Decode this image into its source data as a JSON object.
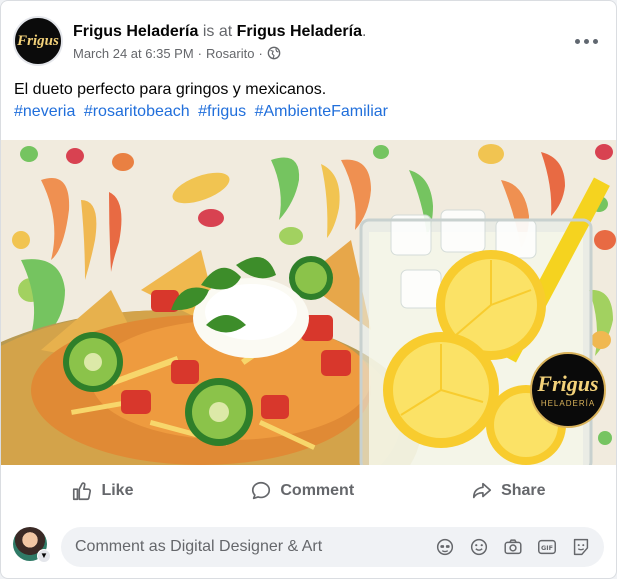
{
  "post": {
    "author": "Frigus Heladería",
    "is_at": "is at",
    "place": "Frigus Heladería",
    "period": ".",
    "date": "March 24 at 6:35 PM",
    "sep": "·",
    "location": "Rosarito",
    "sep2": "·",
    "audience_icon": "globe-icon",
    "message": "El dueto perfecto para gringos y mexicanos.",
    "hashtags": [
      "#neveria",
      "#rosaritobeach",
      "#frigus",
      "#AmbienteFamiliar"
    ],
    "avatar_logo": "Frigus"
  },
  "image": {
    "badge_title": "Frigus",
    "badge_subtitle": "HELADERÍA"
  },
  "actions": {
    "like": "Like",
    "comment": "Comment",
    "share": "Share"
  },
  "composer": {
    "placeholder": "Comment as Digital Designer & Art",
    "icons": [
      "avatar-sticker-icon",
      "emoji-icon",
      "camera-icon",
      "gif-icon",
      "sticker-icon"
    ]
  },
  "colors": {
    "link": "#216fdb",
    "secondary_text": "#65676b",
    "brand_gold": "#f3d27a"
  }
}
